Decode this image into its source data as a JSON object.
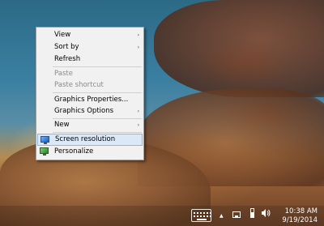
{
  "context_menu": {
    "items": [
      {
        "label": "View",
        "has_submenu": true,
        "enabled": true
      },
      {
        "label": "Sort by",
        "has_submenu": true,
        "enabled": true
      },
      {
        "label": "Refresh",
        "has_submenu": false,
        "enabled": true
      },
      {
        "label": "Paste",
        "has_submenu": false,
        "enabled": false
      },
      {
        "label": "Paste shortcut",
        "has_submenu": false,
        "enabled": false
      },
      {
        "label": "Graphics Properties...",
        "has_submenu": false,
        "enabled": true
      },
      {
        "label": "Graphics Options",
        "has_submenu": true,
        "enabled": true
      },
      {
        "label": "New",
        "has_submenu": true,
        "enabled": true
      },
      {
        "label": "Screen resolution",
        "has_submenu": false,
        "enabled": true,
        "highlighted": true,
        "icon": "screen-resolution-icon"
      },
      {
        "label": "Personalize",
        "has_submenu": false,
        "enabled": true,
        "icon": "personalize-icon"
      }
    ],
    "submenu_arrow": "›"
  },
  "taskbar": {
    "tray_icons": [
      "keyboard-icon",
      "show-hidden-icons-chevron",
      "network-icon",
      "battery-icon",
      "volume-icon"
    ],
    "show_hidden_glyph": "▲",
    "time": "10:38 AM",
    "date": "9/19/2014"
  }
}
